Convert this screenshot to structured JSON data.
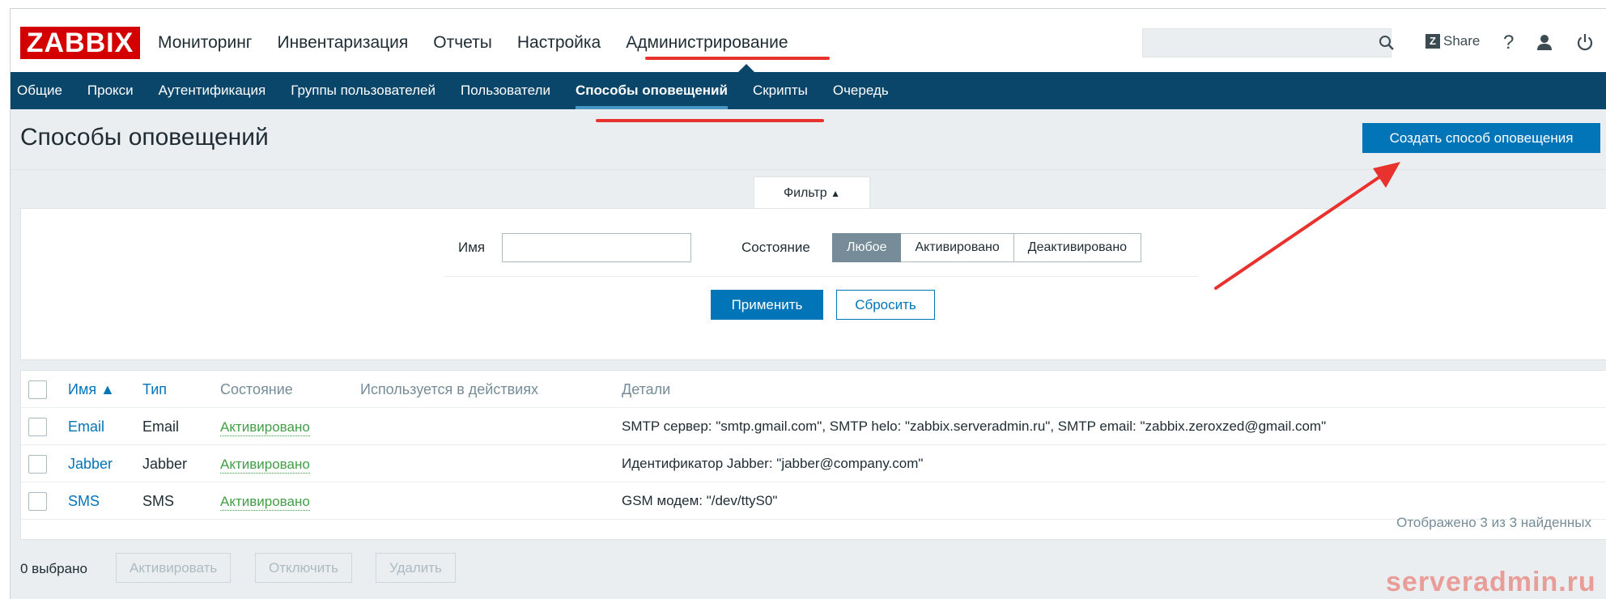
{
  "app": {
    "logo": "ZABBIX",
    "main_menu": [
      "Мониторинг",
      "Инвентаризация",
      "Отчеты",
      "Настройка",
      "Администрирование"
    ],
    "share_label": "Share",
    "help_glyph": "?"
  },
  "subnav": [
    "Общие",
    "Прокси",
    "Аутентификация",
    "Группы пользователей",
    "Пользователи",
    "Способы оповещений",
    "Скрипты",
    "Очередь"
  ],
  "page": {
    "title": "Способы оповещений",
    "create_button": "Создать способ оповещения"
  },
  "filter": {
    "tab_label": "Фильтр",
    "tab_arrow": "▲",
    "name_label": "Имя",
    "name_value": "",
    "state_label": "Состояние",
    "state_options": [
      "Любое",
      "Активировано",
      "Деактивировано"
    ],
    "state_selected": "Любое",
    "apply": "Применить",
    "reset": "Сбросить"
  },
  "table": {
    "headers": {
      "name": "Имя ▲",
      "type": "Тип",
      "state": "Состояние",
      "used": "Используется в действиях",
      "details": "Детали"
    },
    "rows": [
      {
        "name": "Email",
        "type": "Email",
        "state": "Активировано",
        "used": "",
        "details": "SMTP сервер: \"smtp.gmail.com\", SMTP helo: \"zabbix.serveradmin.ru\", SMTP email: \"zabbix.zeroxzed@gmail.com\""
      },
      {
        "name": "Jabber",
        "type": "Jabber",
        "state": "Активировано",
        "used": "",
        "details": "Идентификатор Jabber: \"jabber@company.com\""
      },
      {
        "name": "SMS",
        "type": "SMS",
        "state": "Активировано",
        "used": "",
        "details": "GSM модем: \"/dev/ttyS0\""
      }
    ],
    "footer": "Отображено 3 из 3 найденных"
  },
  "actions": {
    "selected_count": "0 выбрано",
    "activate": "Активировать",
    "disable": "Отключить",
    "delete": "Удалить"
  },
  "watermark": "serveradmin.ru",
  "colors": {
    "logo_red": "#d40000",
    "nav_blue": "#0a466a",
    "primary_blue": "#0275b8",
    "status_green": "#429e47",
    "annotation_red": "#e8322e"
  }
}
